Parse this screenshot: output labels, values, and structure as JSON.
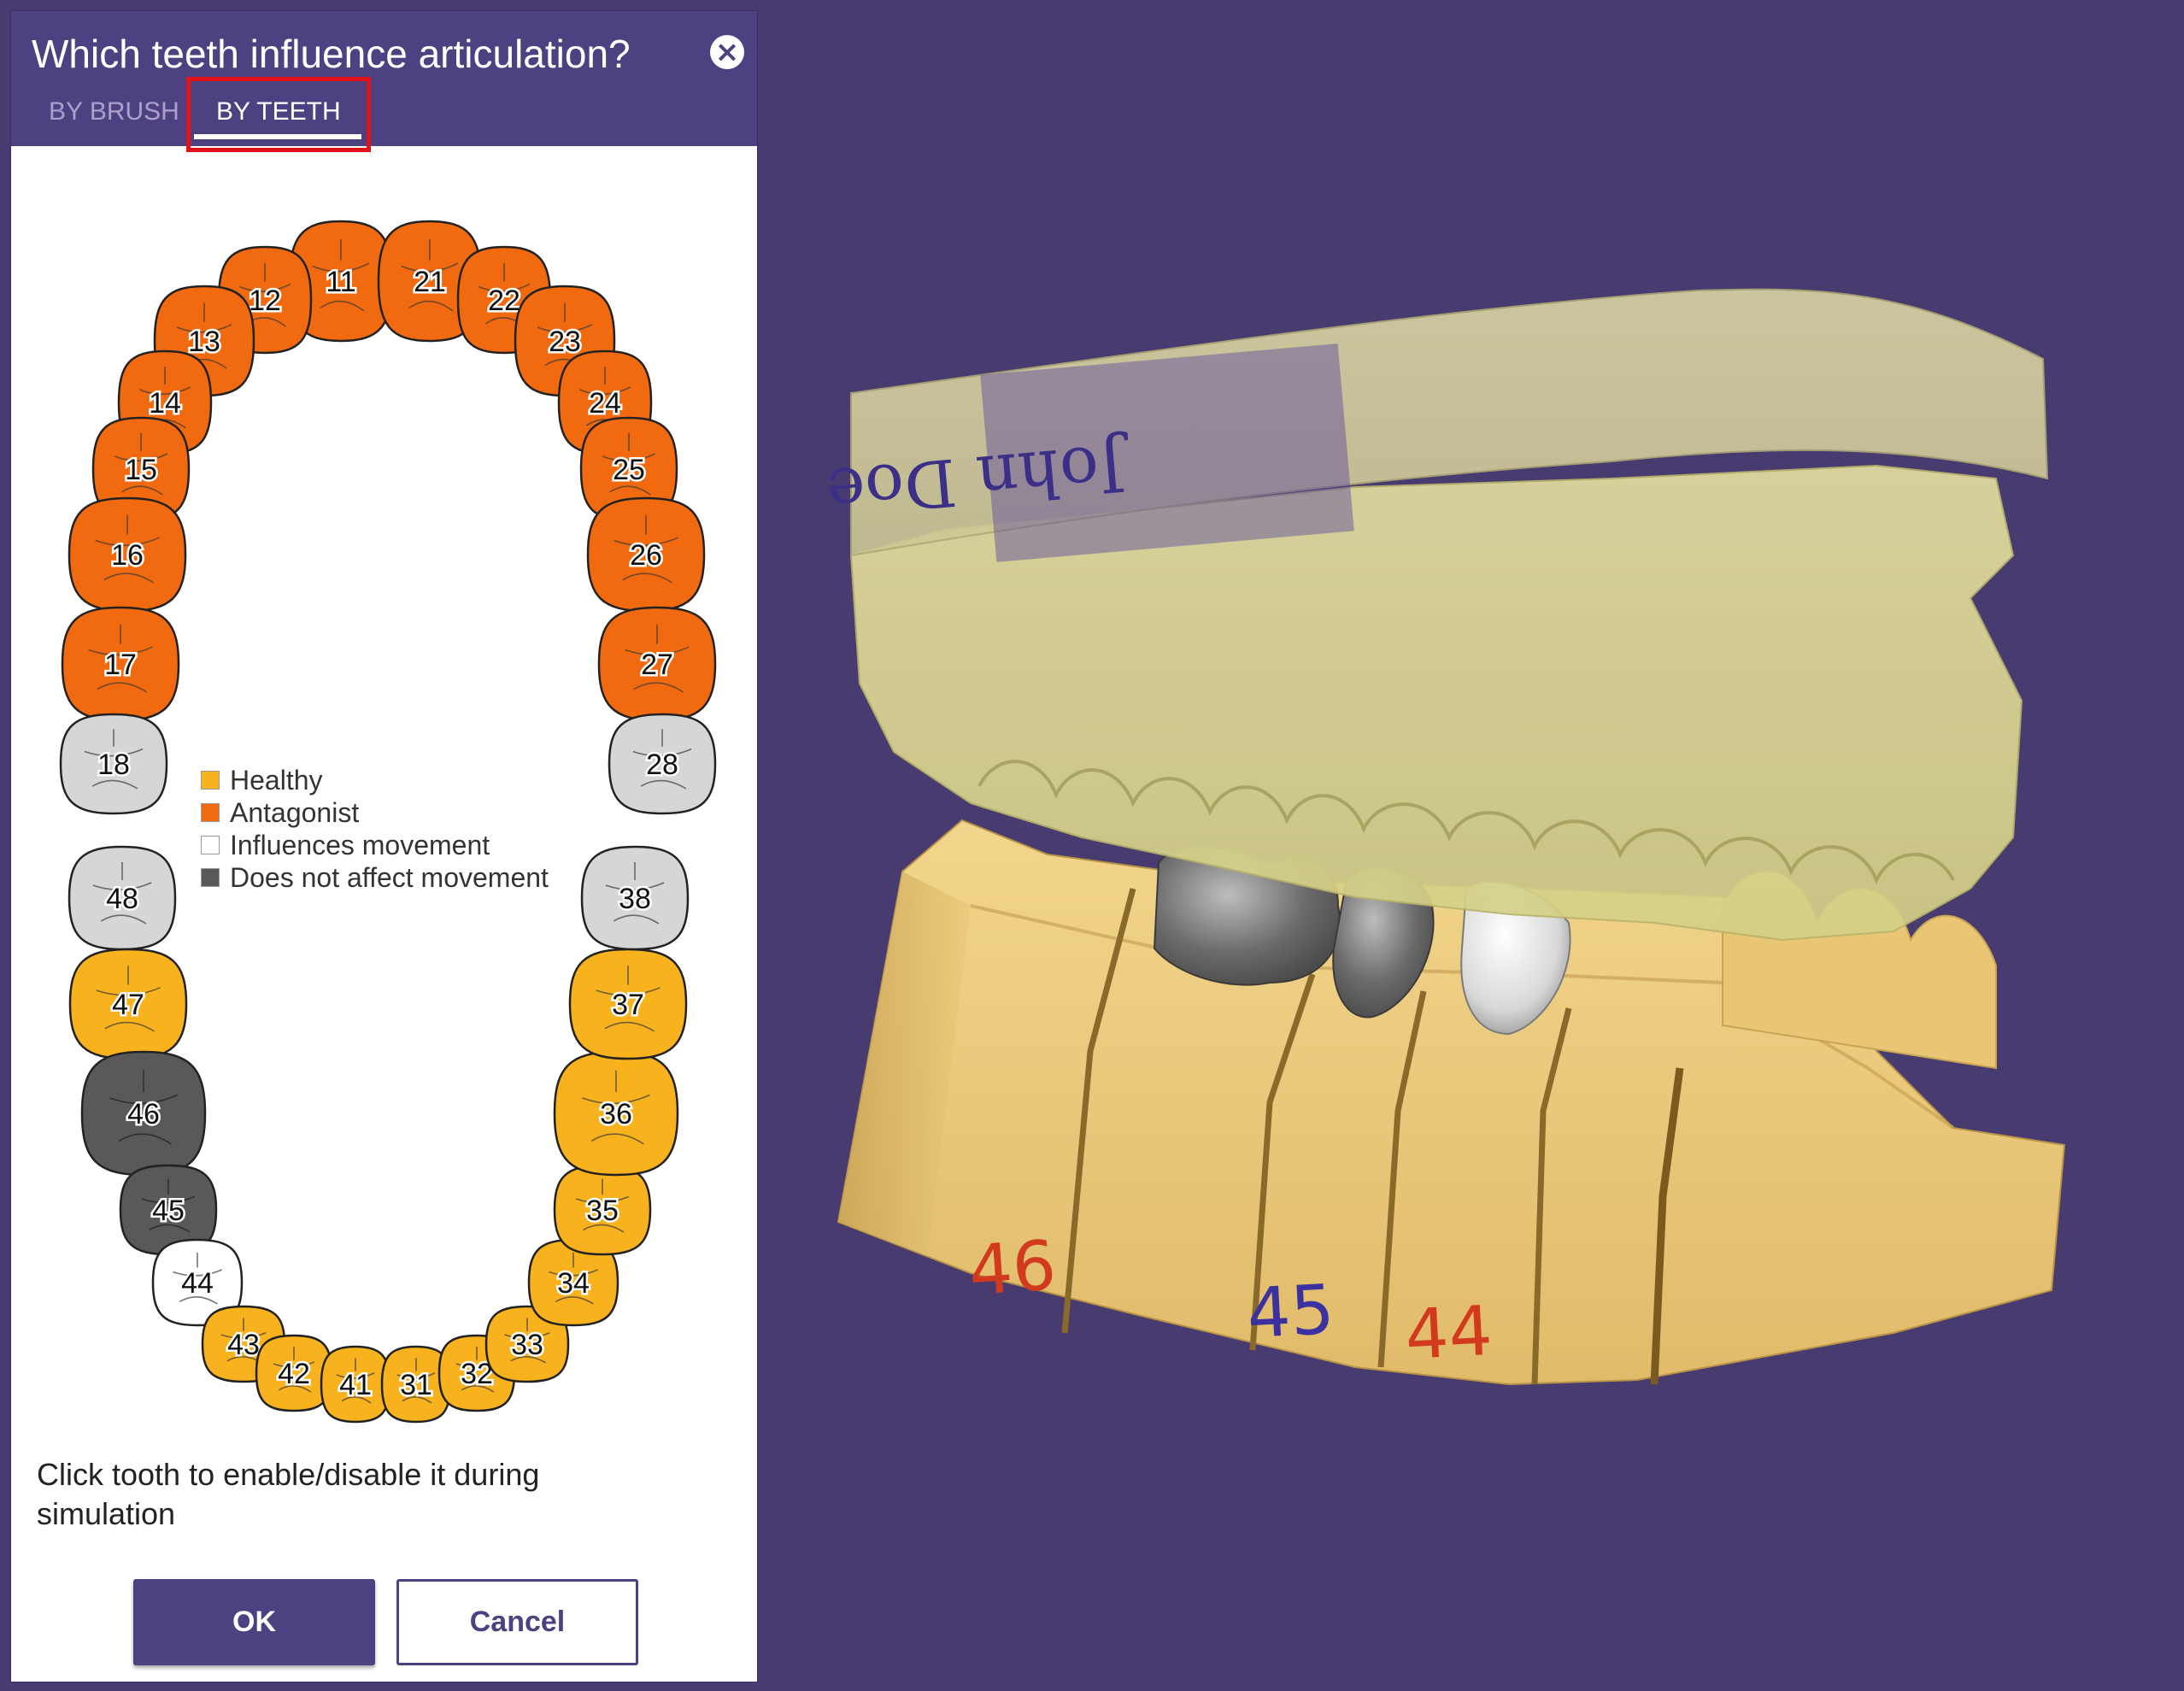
{
  "dialog": {
    "title": "Which teeth influence articulation?",
    "close_icon": "close-icon",
    "tabs": [
      {
        "label": "BY BRUSH",
        "active": false
      },
      {
        "label": "BY TEETH",
        "active": true
      }
    ],
    "hint": "Click tooth to enable/disable it during simulation",
    "ok_label": "OK",
    "cancel_label": "Cancel"
  },
  "legend": [
    {
      "label": "Healthy",
      "color": "#f8b21e"
    },
    {
      "label": "Antagonist",
      "color": "#f26a10"
    },
    {
      "label": "Influences movement",
      "color": "#ffffff"
    },
    {
      "label": "Does not affect movement",
      "color": "#595959"
    }
  ],
  "status_colors": {
    "healthy": "#f8b21e",
    "antagonist": "#f26a10",
    "influences": "#ffffff",
    "disabled": "#595959",
    "missing": "#d6d6d6"
  },
  "teeth": [
    {
      "number": "11",
      "status": "antagonist"
    },
    {
      "number": "12",
      "status": "antagonist"
    },
    {
      "number": "13",
      "status": "antagonist"
    },
    {
      "number": "14",
      "status": "antagonist"
    },
    {
      "number": "15",
      "status": "antagonist"
    },
    {
      "number": "16",
      "status": "antagonist"
    },
    {
      "number": "17",
      "status": "antagonist"
    },
    {
      "number": "18",
      "status": "missing"
    },
    {
      "number": "21",
      "status": "antagonist"
    },
    {
      "number": "22",
      "status": "antagonist"
    },
    {
      "number": "23",
      "status": "antagonist"
    },
    {
      "number": "24",
      "status": "antagonist"
    },
    {
      "number": "25",
      "status": "antagonist"
    },
    {
      "number": "26",
      "status": "antagonist"
    },
    {
      "number": "27",
      "status": "antagonist"
    },
    {
      "number": "28",
      "status": "missing"
    },
    {
      "number": "48",
      "status": "missing"
    },
    {
      "number": "47",
      "status": "healthy"
    },
    {
      "number": "46",
      "status": "disabled"
    },
    {
      "number": "45",
      "status": "disabled"
    },
    {
      "number": "44",
      "status": "influences"
    },
    {
      "number": "43",
      "status": "healthy"
    },
    {
      "number": "42",
      "status": "healthy"
    },
    {
      "number": "41",
      "status": "healthy"
    },
    {
      "number": "31",
      "status": "healthy"
    },
    {
      "number": "32",
      "status": "healthy"
    },
    {
      "number": "33",
      "status": "healthy"
    },
    {
      "number": "34",
      "status": "healthy"
    },
    {
      "number": "35",
      "status": "healthy"
    },
    {
      "number": "36",
      "status": "healthy"
    },
    {
      "number": "37",
      "status": "healthy"
    },
    {
      "number": "38",
      "status": "missing"
    }
  ],
  "model_view": {
    "label_text": "John Doe",
    "die_labels": [
      {
        "text": "46",
        "color": "#d23a1e"
      },
      {
        "text": "45",
        "color": "#3b32a0"
      },
      {
        "text": "44",
        "color": "#d23a1e"
      }
    ]
  }
}
